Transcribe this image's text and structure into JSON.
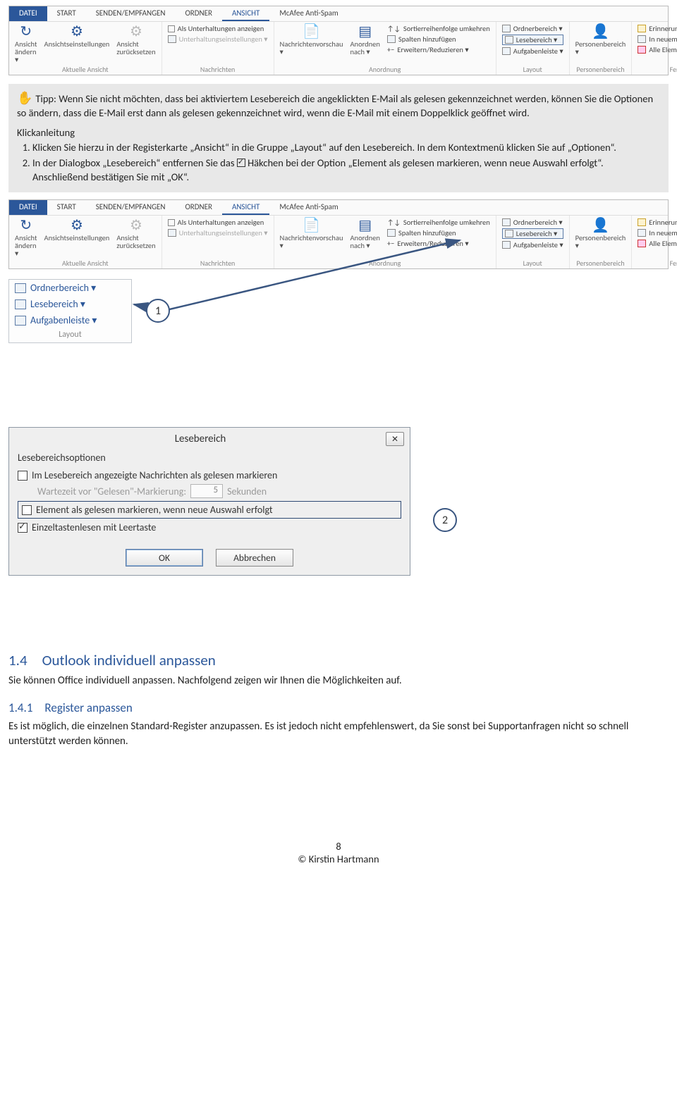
{
  "ribbon": {
    "tabs": [
      "DATEI",
      "START",
      "SENDEN/EMPFANGEN",
      "ORDNER",
      "ANSICHT",
      "McAfee Anti-Spam"
    ],
    "active_tab": "ANSICHT",
    "groups": {
      "g0": {
        "label": "Aktuelle Ansicht",
        "items": {
          "view_change": "Ansicht ändern ▾",
          "view_settings": "Ansichtseinstellungen",
          "view_reset": "Ansicht zurücksetzen"
        }
      },
      "g1": {
        "label": "Nachrichten",
        "items": {
          "show_conv": "Als Unterhaltungen anzeigen",
          "conv_settings": "Unterhaltungseinstellungen ▾"
        }
      },
      "g2": {
        "label": "Anordnung",
        "items": {
          "preview": "Nachrichtenvorschau ▾",
          "arrange": "Anordnen nach ▾",
          "sort_rev": "Sortierreihenfolge umkehren",
          "add_cols": "Spalten hinzufügen",
          "expand": "Erweitern/Reduzieren ▾"
        }
      },
      "g3": {
        "label": "Layout",
        "items": {
          "folder": "Ordnerbereich ▾",
          "reading": "Lesebereich ▾",
          "todo": "Aufgabenleiste ▾"
        }
      },
      "g4": {
        "label": "Personenbereich",
        "items": {
          "people": "Personenbereich ▾"
        }
      },
      "g5": {
        "label": "Fenster",
        "items": {
          "reminders": "Erinnerungsfenster",
          "new_window": "In neuem Fenster öffnen",
          "close_all": "Alle Elemente schließen"
        }
      }
    }
  },
  "tip": {
    "text": "Tipp: Wenn Sie nicht möchten, dass bei aktiviertem Lesebereich die angeklickten E-Mail als gelesen gekennzeichnet werden, können Sie die Optionen so ändern, dass die E-Mail erst dann als gelesen gekennzeichnet wird, wenn die E-Mail mit einem Doppelklick geöffnet wird.",
    "klick_label": "Klickanleitung",
    "step1": "Klicken Sie hierzu in der Registerkarte „Ansicht“ in die Gruppe „Layout“ auf den Lesebereich. In dem Kontextmenü klicken Sie auf „Optionen“.",
    "step2a": "In der Dialogbox „Lesebereich“ entfernen Sie das ",
    "step2b": " Häkchen bei der Option „Element als gelesen markieren, wenn neue Auswahl erfolgt“. Anschließend bestätigen Sie mit „OK“."
  },
  "layout_zoom": {
    "folder": "Ordnerbereich ▾",
    "reading": "Lesebereich ▾",
    "todo": "Aufgabenleiste ▾",
    "group": "Layout"
  },
  "callouts": {
    "c1": "1",
    "c2": "2"
  },
  "dialog": {
    "title": "Lesebereich",
    "sub": "Lesebereichsoptionen",
    "opt1": "Im Lesebereich angezeigte Nachrichten als gelesen markieren",
    "wait_label": "Wartezeit vor \"Gelesen\"-Markierung:",
    "wait_value": "5",
    "wait_unit": "Sekunden",
    "opt2": "Element als gelesen markieren, wenn neue Auswahl erfolgt",
    "opt3": "Einzeltastenlesen mit Leertaste",
    "ok": "OK",
    "cancel": "Abbrechen",
    "close": "✕"
  },
  "sections": {
    "h14": "1.4 Outlook individuell anpassen",
    "p14": "Sie können Office individuell anpassen. Nachfolgend zeigen wir Ihnen die Möglichkeiten auf.",
    "h141": "1.4.1 Register anpassen",
    "p141": "Es ist möglich, die einzelnen Standard-Register anzupassen. Es ist jedoch nicht empfehlenswert, da Sie sonst bei Supportanfragen nicht so schnell unterstützt werden können."
  },
  "footer": {
    "page": "8",
    "copy": "© Kirstin Hartmann"
  }
}
